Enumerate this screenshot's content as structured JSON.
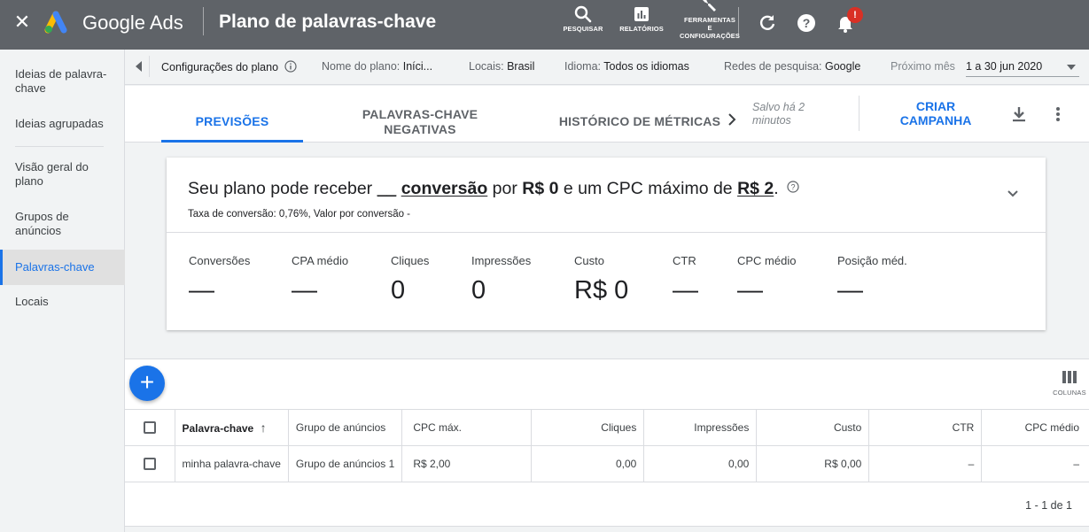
{
  "topbar": {
    "brand": "Google Ads",
    "page_title": "Plano de palavras-chave",
    "tools": [
      {
        "icon": "search-icon",
        "label": "PESQUISAR"
      },
      {
        "icon": "reports-icon",
        "label": "RELATÓRIOS"
      },
      {
        "icon": "wrench-icon",
        "label_lines": [
          "FERRAMENTAS",
          "E",
          "CONFIGURAÇÕES"
        ]
      }
    ],
    "notification_badge": "!"
  },
  "sidebar": {
    "items": [
      {
        "label": "Ideias de palavra-chave"
      },
      {
        "label": "Ideias agrupadas"
      },
      {
        "label": "Visão geral do plano"
      },
      {
        "label": "Grupos de anúncios"
      },
      {
        "label": "Palavras-chave"
      },
      {
        "label": "Locais"
      }
    ],
    "active": "Palavras-chave"
  },
  "settings": {
    "config_label": "Configurações do plano",
    "plan_name_key": "Nome do plano:",
    "plan_name_val": "Iníci...",
    "locations_key": "Locais:",
    "locations_val": "Brasil",
    "language_key": "Idioma:",
    "language_val": "Todos os idiomas",
    "networks_key": "Redes de pesquisa:",
    "networks_val": "Google",
    "period_key": "Próximo mês",
    "period_val": "1 a 30 jun 2020"
  },
  "tabs": [
    {
      "label": "PREVISÕES",
      "active": true
    },
    {
      "label_lines": [
        "PALAVRAS-CHAVE",
        "NEGATIVAS"
      ],
      "active": false
    },
    {
      "label": "HISTÓRICO DE MÉTRICAS",
      "active": false
    }
  ],
  "saved_lines": [
    "Salvo há 2",
    "minutos"
  ],
  "create_campaign_lines": [
    "CRIAR",
    "CAMPANHA"
  ],
  "forecast": {
    "h_pre": "Seu plano pode receber ",
    "h_blank": "__",
    "h_conv": "conversão",
    "h_mid1": " por ",
    "h_cost": "R$ 0",
    "h_mid2": " e um CPC máximo de ",
    "h_cpc": "R$ 2",
    "h_end": ".",
    "conversion_rate": "Taxa de conversão: 0,76%, Valor por conversão -",
    "metrics": [
      {
        "label": "Conversões",
        "value": "—"
      },
      {
        "label": "CPA médio",
        "value": "—"
      },
      {
        "label": "Cliques",
        "value": "0"
      },
      {
        "label": "Impressões",
        "value": "0"
      },
      {
        "label": "Custo",
        "value": "R$ 0"
      },
      {
        "label": "CTR",
        "value": "—"
      },
      {
        "label": "CPC médio",
        "value": "—"
      },
      {
        "label": "Posição méd.",
        "value": "—"
      }
    ]
  },
  "table": {
    "columns_button": "COLUNAS",
    "headers": [
      "Palavra-chave",
      "Grupo de anúncios",
      "CPC máx.",
      "Cliques",
      "Impressões",
      "Custo",
      "CTR",
      "CPC médio"
    ],
    "rows": [
      {
        "keyword": "minha palavra-chave",
        "ad_group": "Grupo de anúncios 1",
        "max_cpc": "R$ 2,00",
        "clicks": "0,00",
        "impressions": "0,00",
        "cost": "R$ 0,00",
        "ctr": "–",
        "avg_cpc": "–"
      }
    ],
    "pagination": "1 - 1 de 1"
  },
  "colors": {
    "topbar": "#5f6368",
    "accent": "#1a73e8",
    "badge": "#d93025"
  }
}
